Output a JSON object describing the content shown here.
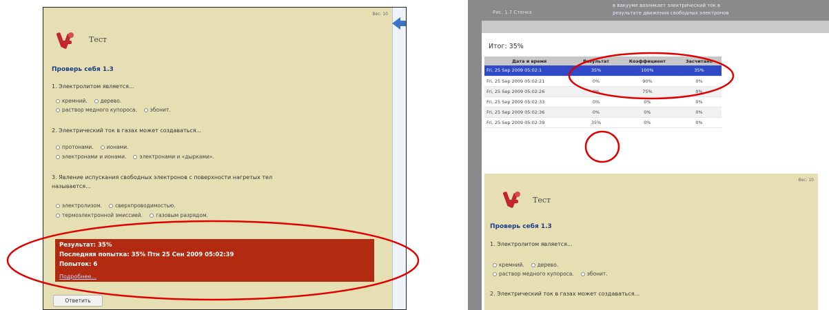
{
  "left": {
    "weight": "Вес: 10",
    "title": "Тест",
    "section": "Проверь себя 1.3",
    "q1": "1. Электролитом является...",
    "q1_opts_row1": [
      "кремний.",
      "дерево."
    ],
    "q1_opts_row2": [
      "раствор медного купороса.",
      "эбонит."
    ],
    "q2": "2. Электрический ток в газах может создаваться...",
    "q2_opts_row1": [
      "протонами.",
      "ионами."
    ],
    "q2_opts_row2": [
      "электронами и ионами.",
      "электронами и «дырками»."
    ],
    "q3_line1": "3. Явление испускания свободных электронов с поверхности нагретых тел",
    "q3_line2": "называется...",
    "q3_opts_row1": [
      "электролизом.",
      "сверхпроводимостью."
    ],
    "q3_opts_row2": [
      "термоэлектронной эмиссией.",
      "газовым разрядом."
    ],
    "result_line": "Результат: 35%",
    "last_attempt": "Последняя попытка: 35% Птн 25 Сен 2009 05:02:39",
    "attempts": "Попыток: 6",
    "more_link": "Подробнее...",
    "answer_button": "Ответить"
  },
  "right": {
    "top_text_left": "Рис. 1.7 Стенка",
    "top_text_right1": "в вакууме возникает электрический ток в",
    "top_text_right2": "результате движения свободных электронов",
    "total": "Итог: 35%",
    "table": {
      "headers": [
        "Дата и время",
        "Результат",
        "Коэффициент",
        "Засчитано"
      ],
      "rows": [
        {
          "date": "Fri, 25 Sep 2009 05:02:1",
          "result": "35%",
          "coef": "100%",
          "counted": "35%",
          "selected": true
        },
        {
          "date": "Fri, 25 Sep 2009 05:02:21",
          "result": "0%",
          "coef": "90%",
          "counted": "0%",
          "selected": false
        },
        {
          "date": "Fri, 25 Sep 2009 05:02:26",
          "result": "0%",
          "coef": "75%",
          "counted": "0%",
          "selected": false
        },
        {
          "date": "Fri, 25 Sep 2009 05:02:33",
          "result": "0%",
          "coef": "0%",
          "counted": "0%",
          "selected": false
        },
        {
          "date": "Fri, 25 Sep 2009 05:02:36",
          "result": "0%",
          "coef": "0%",
          "counted": "0%",
          "selected": false
        },
        {
          "date": "Fri, 25 Sep 2009 05:02:39",
          "result": "35%",
          "coef": "0%",
          "counted": "0%",
          "selected": false
        }
      ]
    },
    "quiz": {
      "weight": "Вес: 10",
      "title": "Тест",
      "section": "Проверь себя 1.3",
      "q1": "1. Электролитом является...",
      "q1_opts_row1": [
        "кремний.",
        "дерево."
      ],
      "q1_opts_row2": [
        "раствор медного купороса.",
        "эбонит."
      ],
      "q2": "2. Электрический ток в газах может создаваться..."
    }
  },
  "colors": {
    "quiz_bg": "#e6dfb4",
    "result_bg": "#b22a10",
    "selected_row": "#2f49c8",
    "annotation": "#e10000",
    "section_link": "#1a3c8c"
  }
}
